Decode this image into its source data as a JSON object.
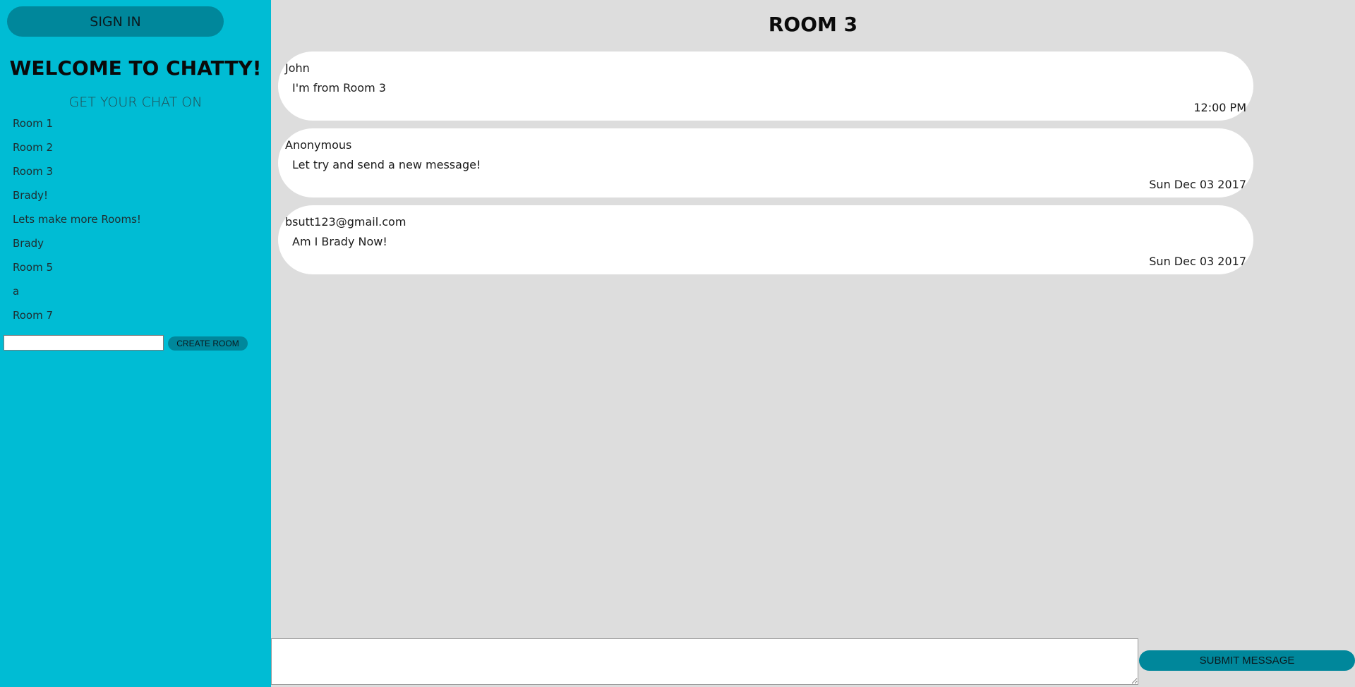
{
  "sidebar": {
    "signin_label": "SIGN IN",
    "welcome_title": "WELCOME TO CHATTY!",
    "tagline": "GET YOUR CHAT ON",
    "rooms": [
      "Room 1",
      "Room 2",
      "Room 3",
      "Brady!",
      "Lets make more Rooms!",
      "Brady",
      "Room 5",
      "a",
      "Room 7"
    ],
    "new_room_value": "",
    "create_room_label": "CREATE ROOM"
  },
  "main": {
    "room_title": "ROOM 3",
    "messages": [
      {
        "user": "John",
        "text": "I'm from Room 3",
        "time": "12:00 PM"
      },
      {
        "user": "Anonymous",
        "text": "Let try and send a new message!",
        "time": "Sun Dec 03 2017"
      },
      {
        "user": "bsutt123@gmail.com",
        "text": "Am I Brady Now!",
        "time": "Sun Dec 03 2017"
      }
    ],
    "composer_value": "",
    "submit_label": "SUBMIT MESSAGE"
  },
  "colors": {
    "sidebar_bg": "#00bcd4",
    "button_bg": "#00879b",
    "main_bg": "#dddddd",
    "bubble_bg": "#ffffff"
  }
}
